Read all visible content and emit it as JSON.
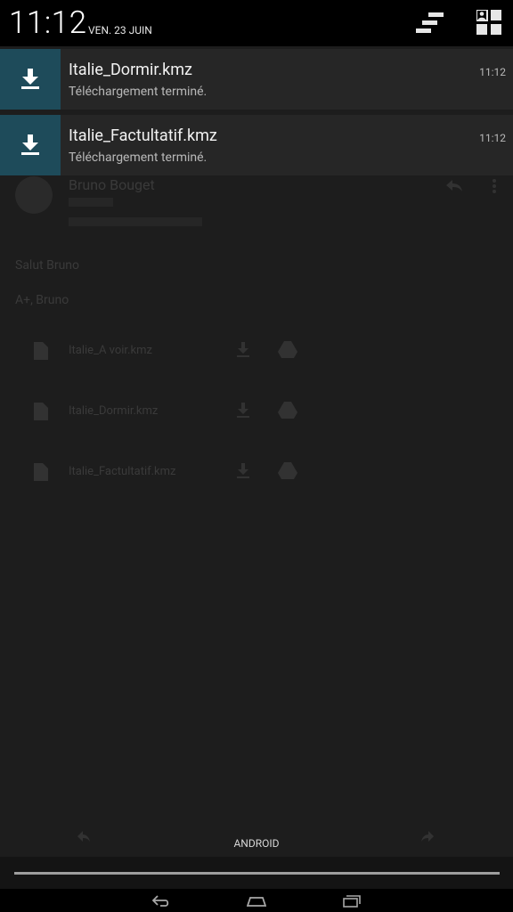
{
  "status_bar": {
    "time": "11:12",
    "date": "VEN. 23 JUIN"
  },
  "notifications": [
    {
      "title": "Italie_Dormir.kmz",
      "text": "Téléchargement terminé.",
      "time": "11:12",
      "icon": "download-icon"
    },
    {
      "title": "Italie_Factultatif.kmz",
      "text": "Téléchargement terminé.",
      "time": "11:12",
      "icon": "download-icon"
    }
  ],
  "background_app": {
    "sender": "Bruno Bouget",
    "line1": "Salut Bruno",
    "line2": "A+, Bruno",
    "attachments": [
      "Italie_A voir.kmz",
      "Italie_Dormir.kmz",
      "Italie_Factultatif.kmz"
    ]
  },
  "carrier": "ANDROID",
  "icons": {
    "clear_all": "clear-all-icon",
    "quick_settings": "quick-settings-icon",
    "back": "back-icon",
    "home": "home-icon",
    "recents": "recents-icon"
  },
  "colors": {
    "notification_icon_bg": "#1e4b5a",
    "notification_bg": "#262626",
    "shade_bg": "#1c1c1c"
  }
}
